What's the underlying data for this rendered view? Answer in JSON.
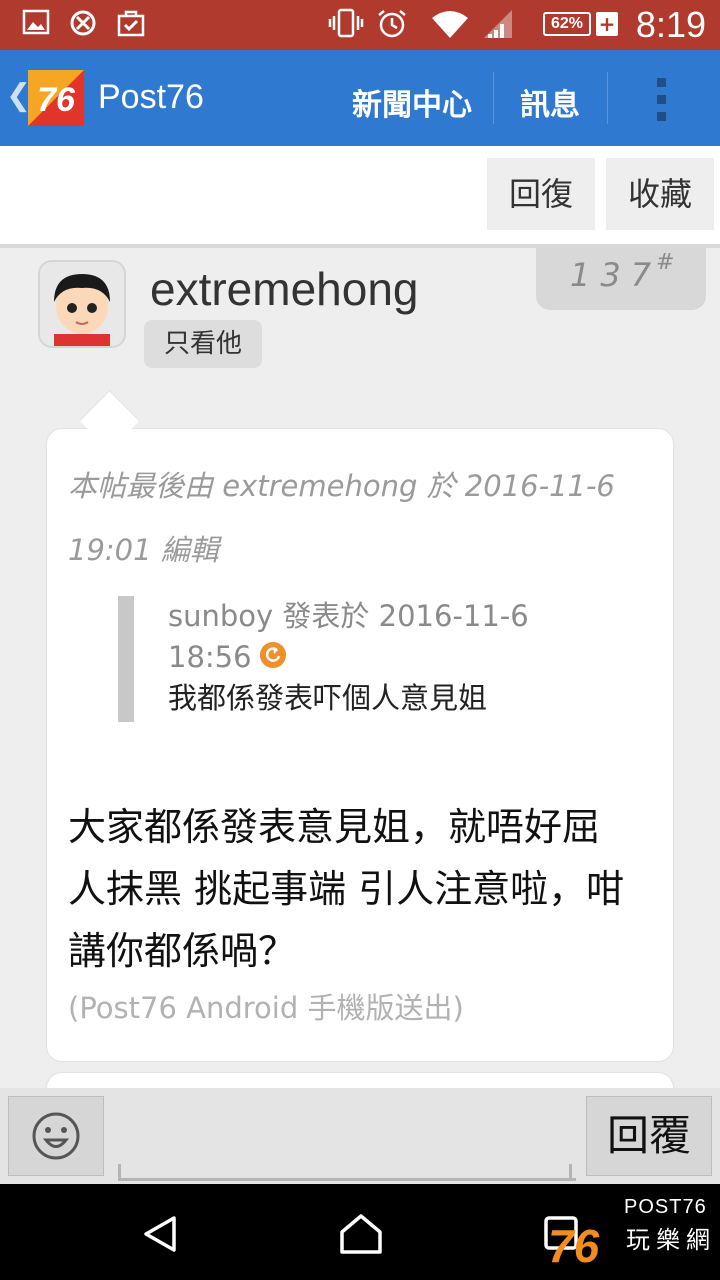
{
  "status_bar": {
    "time": "8:19",
    "battery_percent": "62%",
    "battery_charging": "+",
    "icons": [
      "image-icon",
      "no-sync-icon",
      "bag-check-icon",
      "vibrate-icon",
      "alarm-icon",
      "wifi-icon",
      "signal-icon"
    ]
  },
  "app_bar": {
    "title": "Post76",
    "logo_text": "76",
    "nav_news": "新聞中心",
    "nav_messages": "訊息"
  },
  "toolbar": {
    "reply_label": "回復",
    "favorite_label": "收藏"
  },
  "post": {
    "username": "extremehong",
    "only_him_label": "只看他",
    "floor_number": "137",
    "floor_suffix": "#",
    "edit_note": "本帖最後由 extremehong 於 2016-11-6 19:01 編輯",
    "quote": {
      "header": "sunboy 發表於 2016-11-6",
      "time": "18:56",
      "text": "我都係發表吓個人意見姐"
    },
    "body": "大家都係發表意見姐，就唔好屈人抹黑 挑起事端 引人注意啦，咁講你都係喎？",
    "signature": "(Post76 Android 手機版送出)"
  },
  "bottom_bar": {
    "reply_label": "回覆",
    "input_value": ""
  },
  "watermark": {
    "brand": "POST76",
    "cjk": "玩樂網",
    "logo_digits": "76"
  },
  "colors": {
    "status_bar": "#b03a2e",
    "app_bar": "#2f7ad0",
    "logo_orange": "#f28c1e",
    "logo_red": "#e2342a"
  }
}
